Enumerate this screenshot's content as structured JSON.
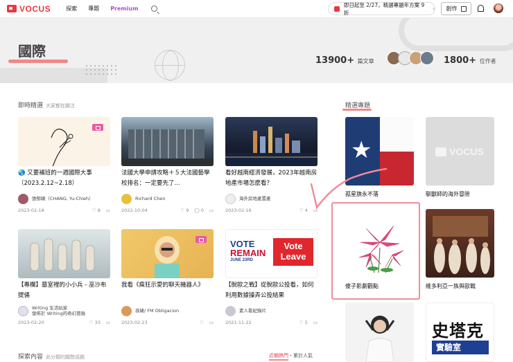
{
  "brand": {
    "name": "VOCUS"
  },
  "nav": {
    "explore": "探索",
    "topics": "專題",
    "premium": "Premium"
  },
  "promo": {
    "text": "即日起至 2/27，精選專題年方案 9 折"
  },
  "create_label": "創作",
  "hero": {
    "title": "國際",
    "articles_count": "13900+",
    "articles_unit": "篇文章",
    "authors_count": "1800+",
    "authors_unit": "位作者"
  },
  "latest": {
    "heading": "即時精選",
    "sub": "大家都在關注"
  },
  "featured": {
    "heading": "精選專題"
  },
  "explore": {
    "heading": "探索內容",
    "sub": "此分類的趨勢話題",
    "tab_active": "近期熱門",
    "tab_sep": "・",
    "tab_other": "累計人氣"
  },
  "cards": [
    {
      "title": "🌏 又要補班的一週國際大事（2023.2.12~2.18）",
      "author": "張郁婕（CHANG, Yu-Chieh）",
      "author2": "",
      "date": "2023-02-18",
      "likes": "8",
      "comments": ""
    },
    {
      "title": "法國大學申請攻略＋５大法國藝學校排名：一定要先了...",
      "author": "Richard Chen",
      "author2": "",
      "date": "2022-10-04",
      "likes": "9",
      "comments": "0"
    },
    {
      "title": "看好越南經濟發展，2023年越南房地產市場怎麼看？",
      "author": "海外房地產置產",
      "author2": "",
      "date": "2023-02-16",
      "likes": "4",
      "comments": ""
    },
    {
      "title": "【專欄】墓室裡的小小兵 - 巫沙布提俑",
      "author": "Writing 生活玩家",
      "author2": "發佈於 Writing的奇幻冒險",
      "date": "2023-02-20",
      "likes": "33",
      "comments": ""
    },
    {
      "title": "我看《瘋狂示愛的聊天機器人》",
      "author": "孫婕/ FM Obligacion",
      "author2": "",
      "date": "2023-02-23",
      "likes": "",
      "comments": ""
    },
    {
      "title": "【脫歐之戰】從脫歐公投看，如何利用數據操弄公投結果",
      "author": "素人看紀錄片",
      "author2": "",
      "date": "2021-11-22",
      "likes": "5",
      "comments": ""
    }
  ],
  "vote": {
    "remain_line1": "VOTE",
    "remain_line2": "REMAIN",
    "remain_date": "JUNE 23RD",
    "leave_line1": "Vote",
    "leave_line2": "Leave"
  },
  "topics": [
    {
      "label": "孤星旗永不落"
    },
    {
      "label": "馴獸師的海外冒險",
      "logo": "VOCUS"
    },
    {
      "label": "傻子影劇觀點"
    },
    {
      "label": "維多利亞一族與歐戰"
    },
    {
      "label": ""
    },
    {
      "label": "",
      "banner1": "史塔克",
      "banner2": "實驗室"
    }
  ],
  "colors": {
    "accent": "#e63946",
    "highlight": "#f08888",
    "premium": "#b44cd6"
  }
}
